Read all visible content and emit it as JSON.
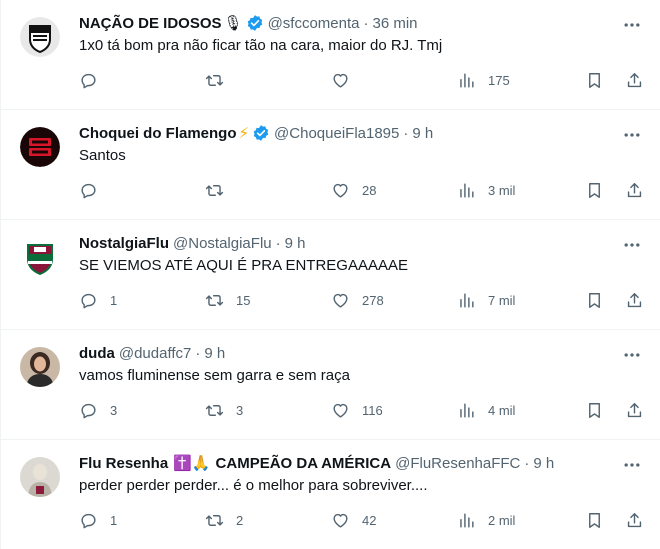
{
  "tweets": [
    {
      "name": "NAÇÃO DE IDOSOS",
      "name_emoji": "🎙",
      "verified": true,
      "handle": "@sfccomenta",
      "time": "36 min",
      "text": "1x0 tá bom pra não ficar tão na cara, maior do RJ. Tmj",
      "replies": "",
      "retweets": "",
      "likes": "",
      "views": "175",
      "avatar_icon": "shield-crest-icon"
    },
    {
      "name": "Choquei do Flamengo",
      "name_emoji": "⚡",
      "verified": true,
      "handle": "@ChoqueiFla1895",
      "time": "9 h",
      "text": "Santos",
      "replies": "",
      "retweets": "",
      "likes": "28",
      "views": "3 mil",
      "avatar_icon": "choquei-logo-icon"
    },
    {
      "name": "NostalgiaFlu",
      "name_emoji": "",
      "verified": false,
      "handle": "@NostalgiaFlu",
      "time": "9 h",
      "text": "SE VIEMOS ATÉ AQUI É PRA ENTREGAAAAAE",
      "replies": "1",
      "retweets": "15",
      "likes": "278",
      "views": "7 mil",
      "avatar_icon": "fluminense-crest-icon"
    },
    {
      "name": "duda",
      "name_emoji": "",
      "verified": false,
      "handle": "@dudaffc7",
      "time": "9 h",
      "text": "vamos fluminense sem garra e sem raça",
      "replies": "3",
      "retweets": "3",
      "likes": "116",
      "views": "4 mil",
      "avatar_icon": "user-photo-icon"
    },
    {
      "name": "Flu Resenha",
      "name_emoji": "✝️🙏",
      "name_suffix": "CAMPEÃO DA AMÉRICA",
      "verified": false,
      "handle": "@FluResenhaFFC",
      "time": "9 h",
      "text": "perder perder perder... é o melhor para sobreviver....",
      "replies": "1",
      "retweets": "2",
      "likes": "42",
      "views": "2 mil",
      "avatar_icon": "user-photo-icon"
    }
  ],
  "time_separator": "·",
  "colors": {
    "text": "#0f1419",
    "secondary": "#536471",
    "verified": "#1d9bf0",
    "border": "#eff3f4"
  }
}
